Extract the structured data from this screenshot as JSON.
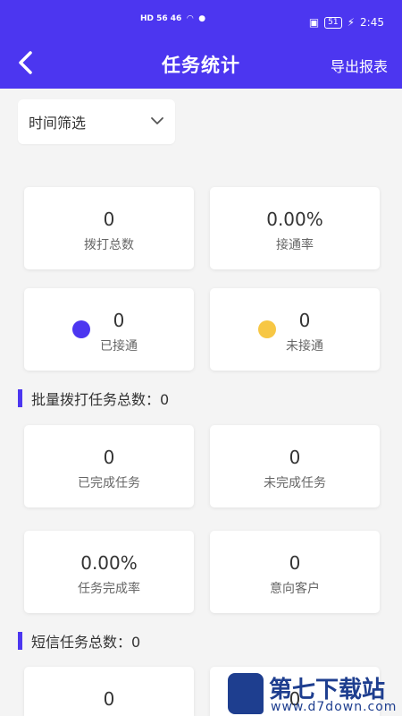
{
  "status": {
    "time": "2:45",
    "battery": "51",
    "left_text": "HD 56 46"
  },
  "header": {
    "title": "任务统计",
    "export_label": "导出报表"
  },
  "filter": {
    "label": "时间筛选"
  },
  "stats": [
    {
      "value": "0",
      "label": "拨打总数"
    },
    {
      "value": "0.00%",
      "label": "接通率"
    },
    {
      "value": "0",
      "label": "已接通",
      "dot_color": "#4c36f0"
    },
    {
      "value": "0",
      "label": "未接通",
      "dot_color": "#f7c744"
    }
  ],
  "batch": {
    "title": "批量拨打任务总数：0",
    "cards": [
      {
        "value": "0",
        "label": "已完成任务"
      },
      {
        "value": "0",
        "label": "未完成任务"
      },
      {
        "value": "0.00%",
        "label": "任务完成率"
      },
      {
        "value": "0",
        "label": "意向客户"
      }
    ]
  },
  "sms": {
    "title": "短信任务总数：0",
    "cards": [
      {
        "value": "0",
        "label": ""
      },
      {
        "value": "0",
        "label": ""
      }
    ]
  },
  "watermark": {
    "name": "第七下载站",
    "url": "www.d7down.com"
  },
  "colors": {
    "primary": "#4c36f0",
    "accent_yellow": "#f7c744",
    "background": "#f4f4f4"
  }
}
